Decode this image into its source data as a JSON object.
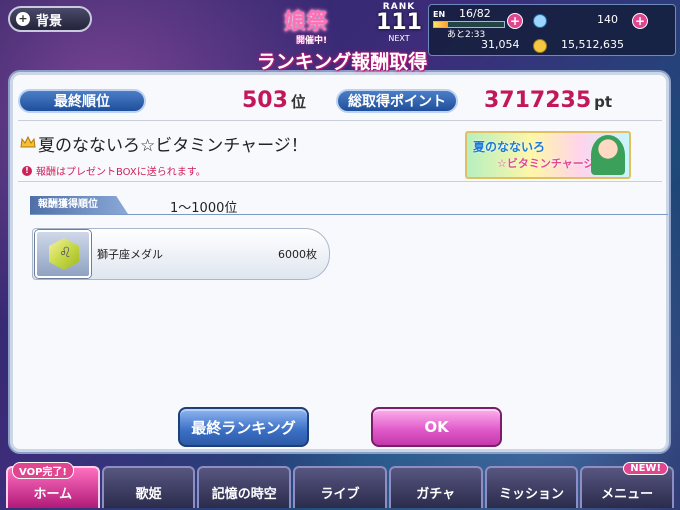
{
  "header": {
    "back_label": "背景",
    "event_logo": "娘祭",
    "event_sub": "開催中!",
    "rank_label": "RANK",
    "rank_value": "111",
    "rank_next": "NEXT",
    "energy_label": "EN",
    "energy_value": "16/82",
    "energy_fraction": 0.195,
    "energy_timer": "あと2:33",
    "gem_count": "140",
    "exp_value": "31,054",
    "money_value": "15,512,635"
  },
  "dialog": {
    "title": "ランキング報酬取得",
    "final_rank_label": "最終順位",
    "final_rank_value": "503",
    "final_rank_unit": "位",
    "points_label": "総取得ポイント",
    "points_value": "3717235",
    "points_unit": "pt",
    "event_name": "夏のなないろ☆ビタミンチャージ！",
    "notice": "報酬はプレゼントBOXに送られます。",
    "banner_title": "夏のなないろ",
    "banner_subtitle": "☆ビタミンチャージ！",
    "reward_tab": "報酬獲得順位",
    "reward_range": "1〜1000位",
    "reward_item": {
      "name": "獅子座メダル",
      "quantity": "6000枚"
    },
    "ranking_button": "最終ランキング",
    "ok_button": "OK"
  },
  "nav": {
    "badge_left": "VOP完了!",
    "badge_right": "NEW!",
    "items": [
      "ホーム",
      "歌姫",
      "記憶の時空",
      "ライブ",
      "ガチャ",
      "ミッション",
      "メニュー"
    ]
  }
}
